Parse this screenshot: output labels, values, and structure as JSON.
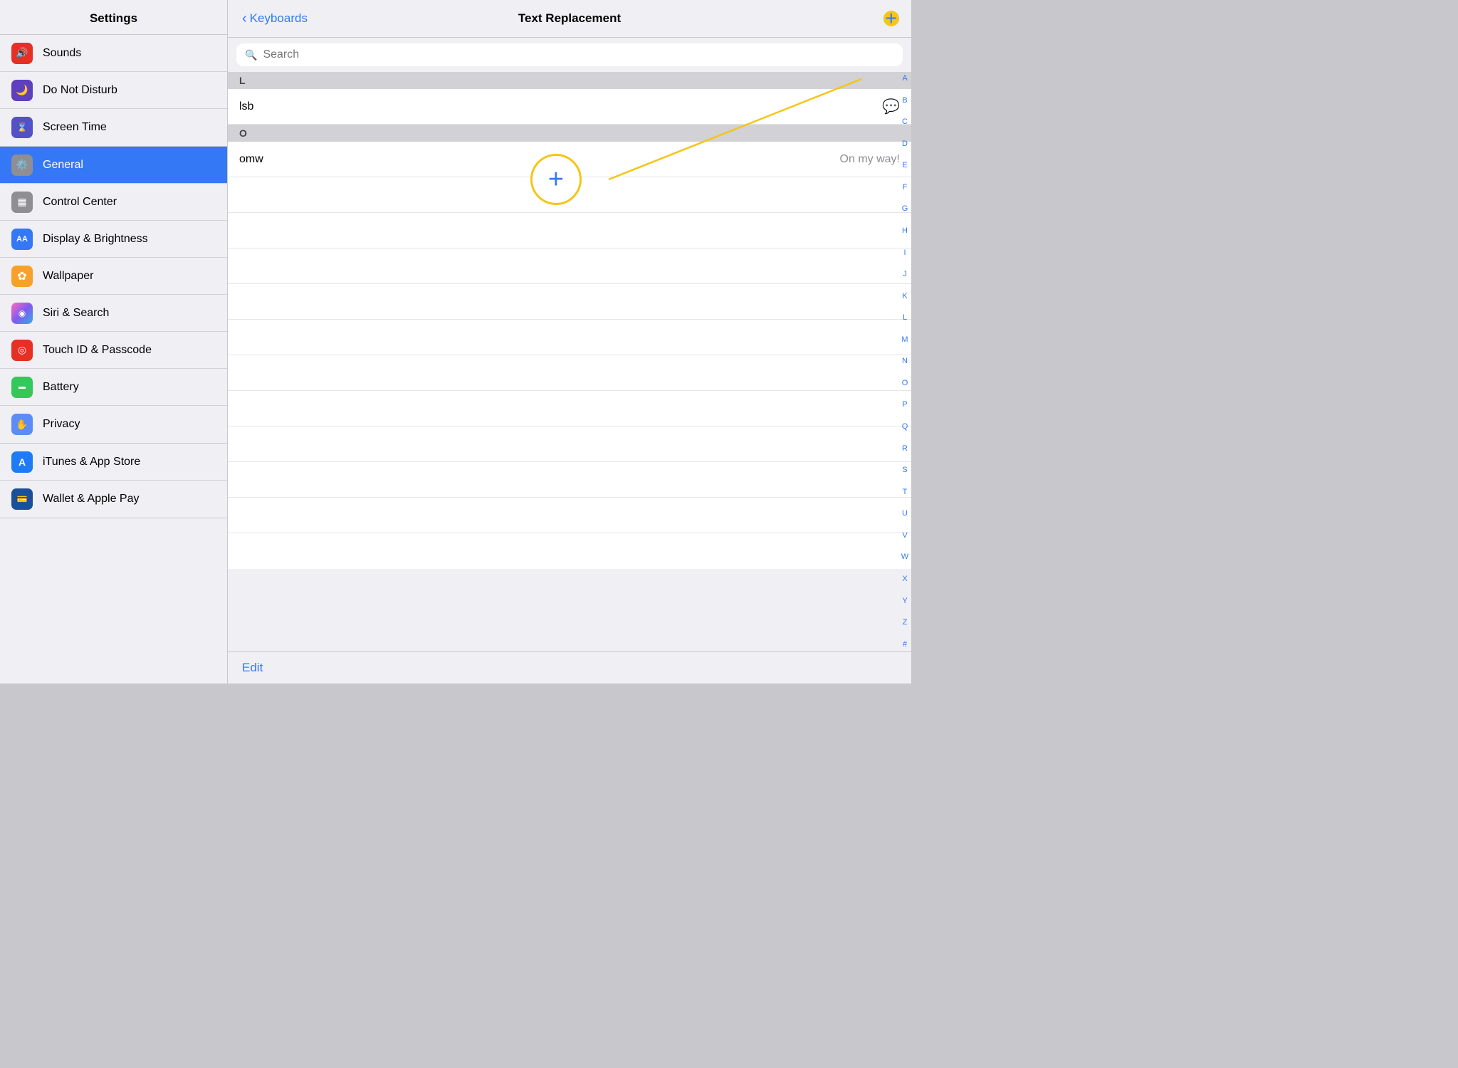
{
  "sidebar": {
    "title": "Settings",
    "sections": [
      {
        "items": [
          {
            "id": "sounds",
            "label": "Sounds",
            "icon": "🔊",
            "iconClass": "icon-red"
          },
          {
            "id": "do-not-disturb",
            "label": "Do Not Disturb",
            "icon": "🌙",
            "iconClass": "icon-purple"
          },
          {
            "id": "screen-time",
            "label": "Screen Time",
            "icon": "⌛",
            "iconClass": "icon-indigo"
          }
        ]
      },
      {
        "items": [
          {
            "id": "general",
            "label": "General",
            "icon": "⚙️",
            "iconClass": "icon-gray",
            "active": true
          },
          {
            "id": "control-center",
            "label": "Control Center",
            "icon": "⊞",
            "iconClass": "icon-gray"
          },
          {
            "id": "display-brightness",
            "label": "Display & Brightness",
            "icon": "AA",
            "iconClass": "icon-blue-light"
          },
          {
            "id": "wallpaper",
            "label": "Wallpaper",
            "icon": "✿",
            "iconClass": "icon-orange"
          },
          {
            "id": "siri-search",
            "label": "Siri & Search",
            "icon": "◉",
            "iconClass": "icon-teal"
          },
          {
            "id": "touch-id",
            "label": "Touch ID & Passcode",
            "icon": "◎",
            "iconClass": "icon-red"
          },
          {
            "id": "battery",
            "label": "Battery",
            "icon": "▬",
            "iconClass": "icon-green"
          },
          {
            "id": "privacy",
            "label": "Privacy",
            "icon": "✋",
            "iconClass": "icon-hand"
          }
        ]
      },
      {
        "items": [
          {
            "id": "itunes-app-store",
            "label": "iTunes & App Store",
            "icon": "A",
            "iconClass": "icon-store"
          },
          {
            "id": "wallet-apple-pay",
            "label": "Wallet & Apple Pay",
            "icon": "💳",
            "iconClass": "icon-wallet"
          }
        ]
      }
    ]
  },
  "main": {
    "nav": {
      "back_label": "Keyboards",
      "title": "Text Replacement",
      "add_button_label": "+"
    },
    "search": {
      "placeholder": "Search"
    },
    "sections": [
      {
        "header": "L",
        "items": [
          {
            "shortcut": "lsb",
            "replacement": "",
            "has_bubble": true
          }
        ]
      },
      {
        "header": "O",
        "items": [
          {
            "shortcut": "omw",
            "replacement": "On my way!"
          }
        ]
      }
    ],
    "alpha_index": [
      "A",
      "B",
      "C",
      "D",
      "E",
      "F",
      "G",
      "H",
      "I",
      "J",
      "K",
      "L",
      "M",
      "N",
      "O",
      "P",
      "Q",
      "R",
      "S",
      "T",
      "U",
      "V",
      "W",
      "X",
      "Y",
      "Z",
      "#"
    ],
    "bottom": {
      "edit_label": "Edit"
    }
  }
}
